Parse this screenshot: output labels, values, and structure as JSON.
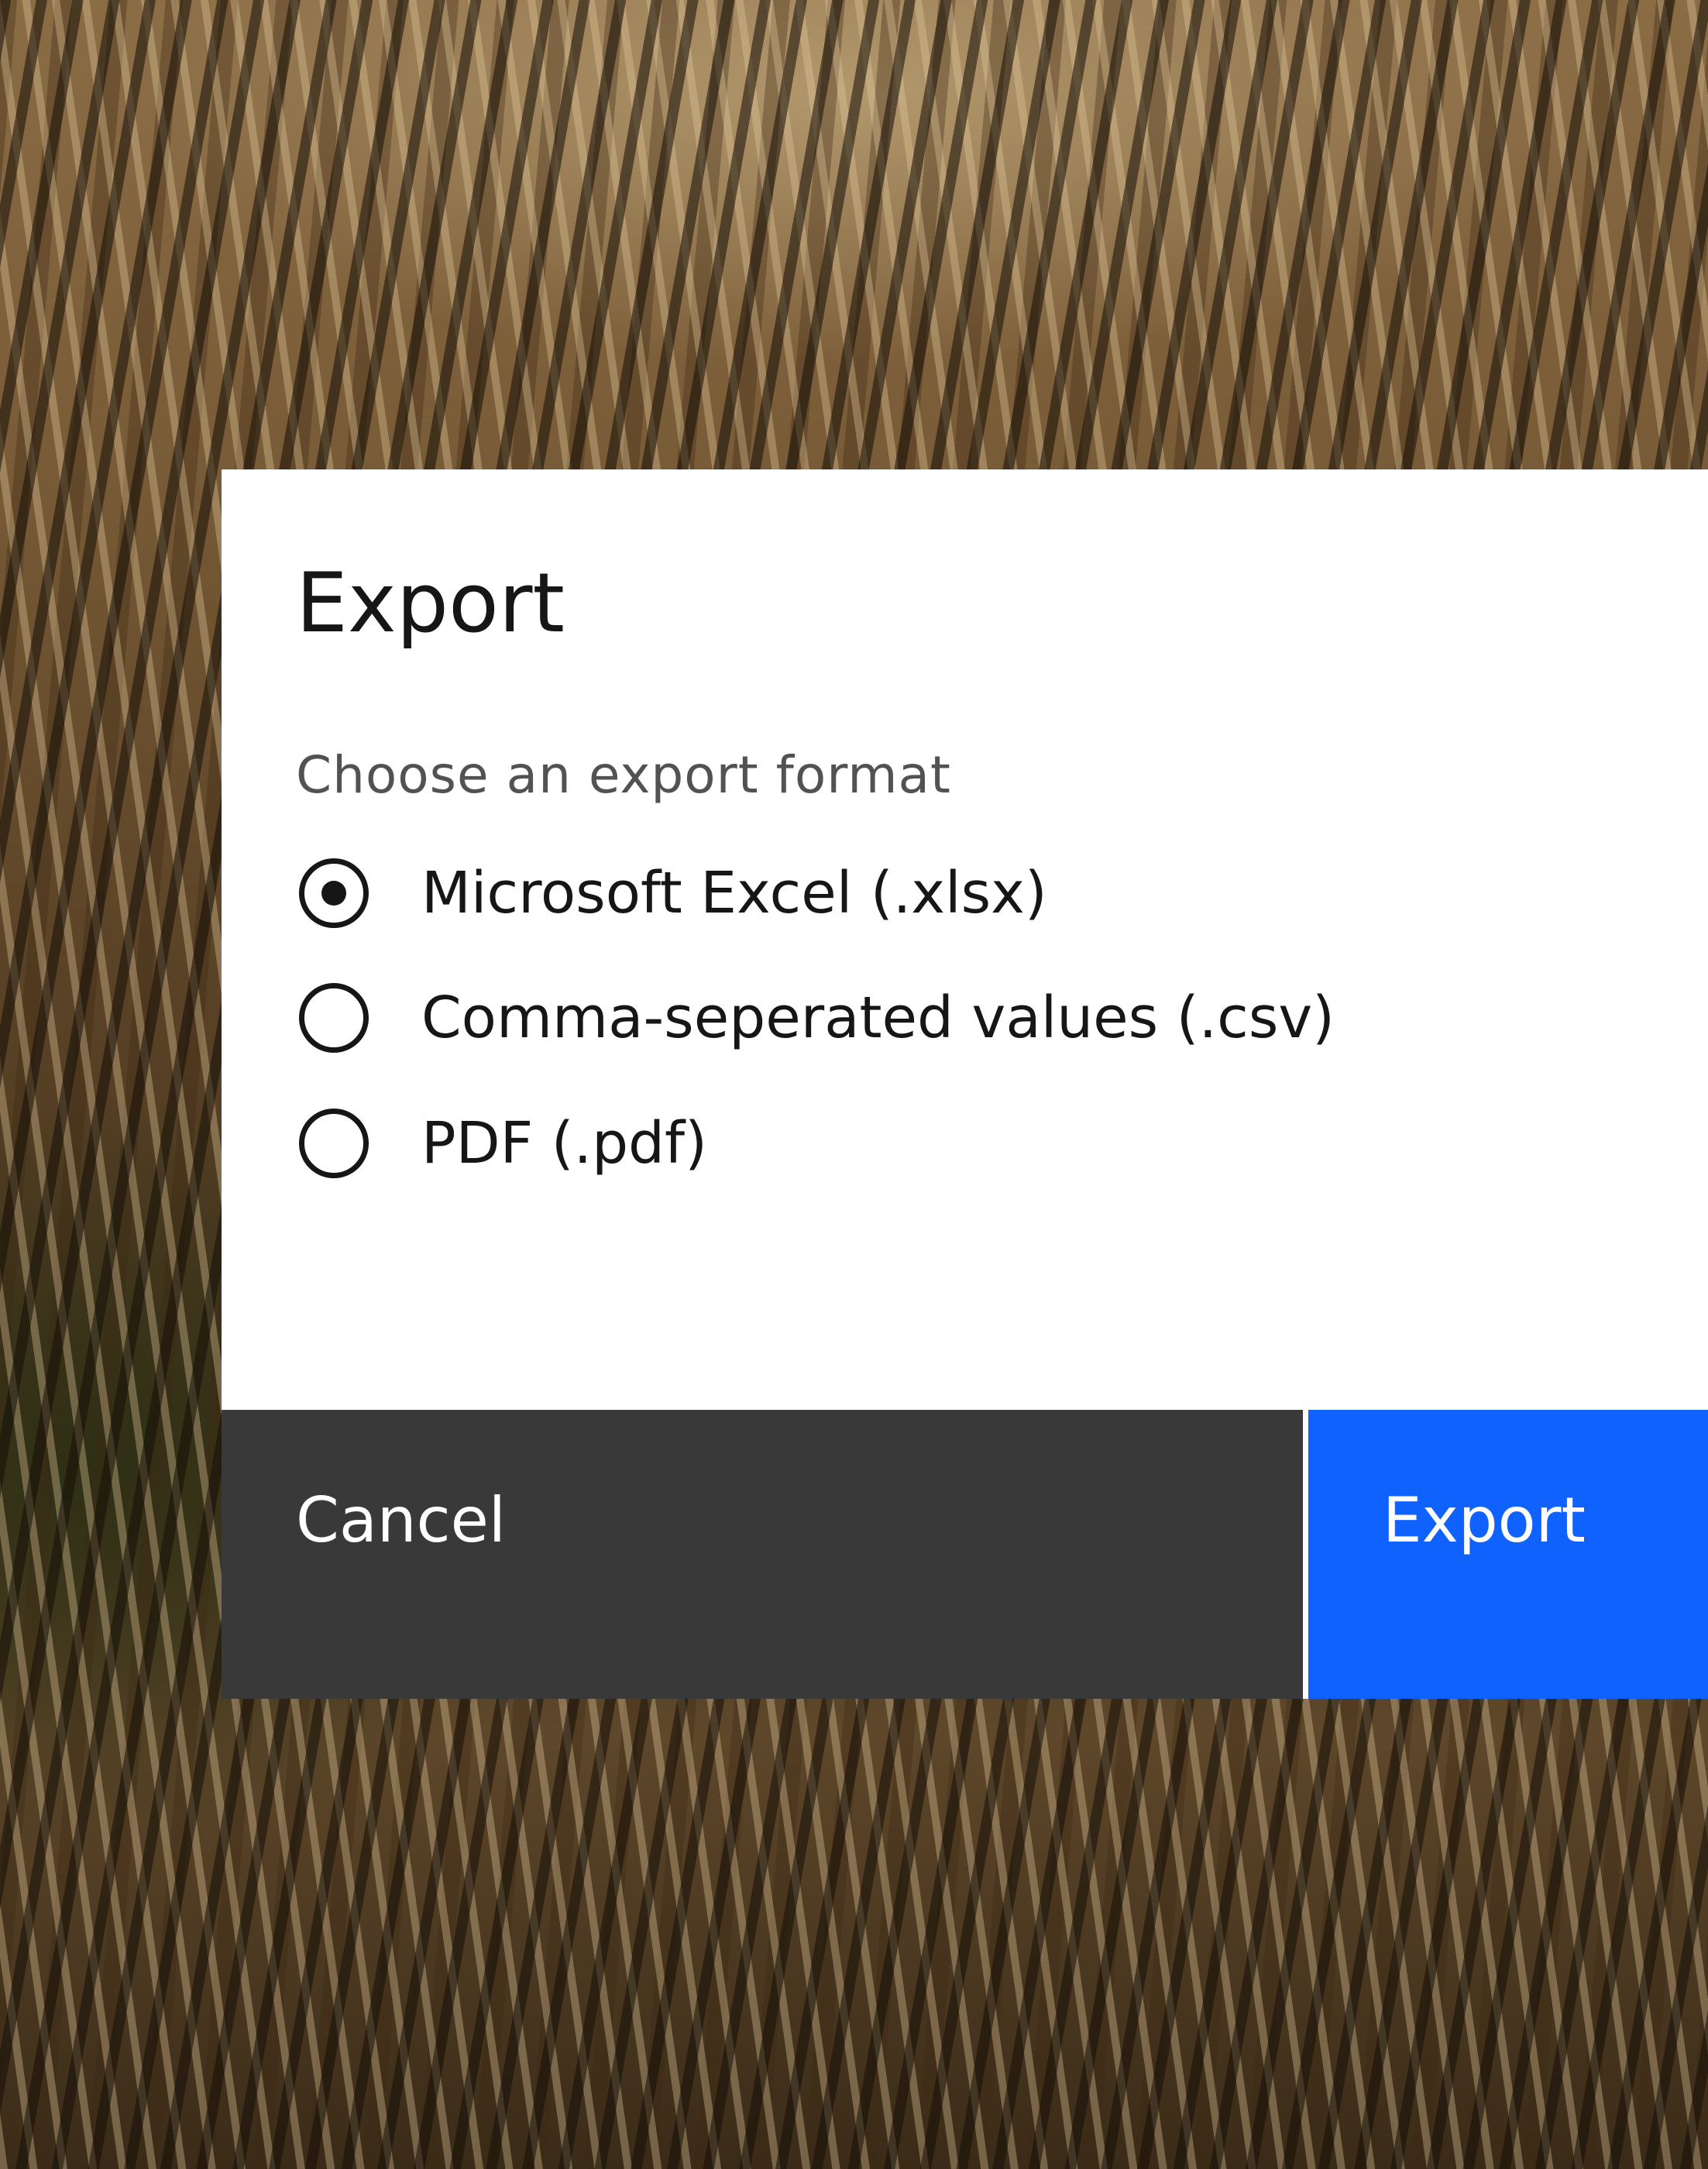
{
  "modal": {
    "title": "Export",
    "field_label": "Choose an export format",
    "options": [
      {
        "label": "Microsoft Excel (.xlsx)",
        "selected": true
      },
      {
        "label": "Comma-seperated values (.csv)",
        "selected": false
      },
      {
        "label": "PDF (.pdf)",
        "selected": false
      }
    ],
    "buttons": {
      "cancel_label": "Cancel",
      "primary_label": "Export"
    }
  },
  "colors": {
    "primary_button": "#0f62fe",
    "secondary_button": "#393939",
    "text_primary": "#161616",
    "text_secondary": "#525252"
  }
}
